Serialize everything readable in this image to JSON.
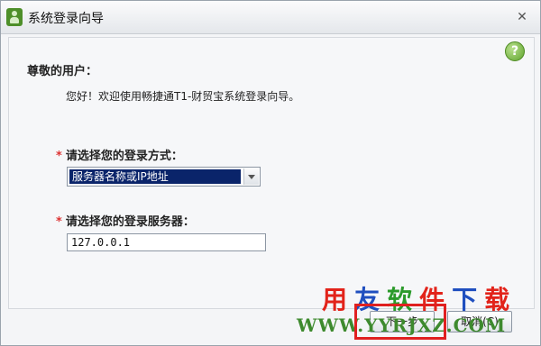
{
  "window": {
    "title": "系统登录向导",
    "close_label": "✕"
  },
  "help": {
    "label": "?"
  },
  "greeting": "尊敬的用户：",
  "welcome": "您好！欢迎使用畅捷通T1-财贸宝系统登录向导。",
  "login_method": {
    "required_mark": "*",
    "label": "请选择您的登录方式：",
    "selected": "服务器名称或IP地址"
  },
  "server": {
    "required_mark": "*",
    "label": "请选择您的登录服务器：",
    "value": "127.0.0.1"
  },
  "buttons": {
    "next": "下一步",
    "cancel": "取消(C)"
  },
  "watermark": {
    "chars": [
      "用",
      "友",
      "软",
      "件",
      "下",
      "载"
    ],
    "url": "WWW.YYRJXZ.COM"
  },
  "colors": {
    "highlight": "#e02020",
    "select_bg": "#0a246a",
    "help_green": "#5fa42c"
  }
}
